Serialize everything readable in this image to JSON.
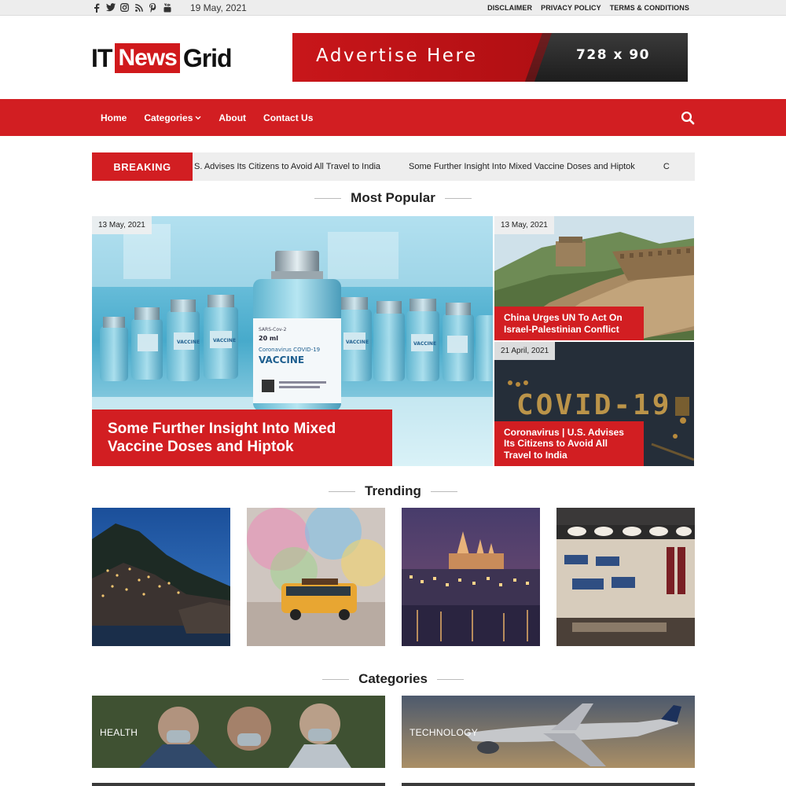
{
  "topbar": {
    "social_icons": [
      "facebook-icon",
      "twitter-icon",
      "instagram-icon",
      "rss-icon",
      "pinterest-icon",
      "youtube-icon"
    ],
    "date": "19 May, 2021",
    "links": [
      "DISCLAIMER",
      "PRIVACY POLICY",
      "TERMS & CONDITIONS"
    ]
  },
  "logo": {
    "part1": "IT",
    "part2": "News",
    "part3": "Grid"
  },
  "ad": {
    "text": "Advertise Here",
    "size": "728 x 90"
  },
  "nav": {
    "items": [
      "Home",
      "Categories",
      "About",
      "Contact Us"
    ],
    "categories_caret": "⌄"
  },
  "breaking": {
    "label": "BREAKING",
    "items": [
      "S. Advises Its Citizens to Avoid All Travel to India",
      "Some Further Insight Into Mixed Vaccine Doses and Hiptok",
      "C"
    ]
  },
  "sections": {
    "most_popular": "Most Popular",
    "trending": "Trending",
    "categories": "Categories"
  },
  "popular": {
    "big": {
      "date": "13 May, 2021",
      "title": "Some Further Insight Into Mixed Vaccine Doses and Hiptok"
    },
    "top_right": {
      "date": "13 May, 2021",
      "title": "China Urges UN To Act On Israel-Palestinian Conflict"
    },
    "bottom_right": {
      "date": "21 April, 2021",
      "title": "Coronavirus | U.S. Advises Its Citizens to Avoid All Travel to India"
    },
    "vial_labels": {
      "small": "VACCINE",
      "big_top": "SARS-Cov-2",
      "big_ml": "20 ml",
      "big_name": "Coronavirus COVID-19",
      "big_word": "VACCINE"
    },
    "covid_letters": "COVID-19"
  },
  "categories": [
    "HEALTH",
    "TECHNOLOGY"
  ],
  "colors": {
    "accent": "#d21e22",
    "topbar": "#ededed",
    "ticker_bg": "#eeeeee"
  }
}
